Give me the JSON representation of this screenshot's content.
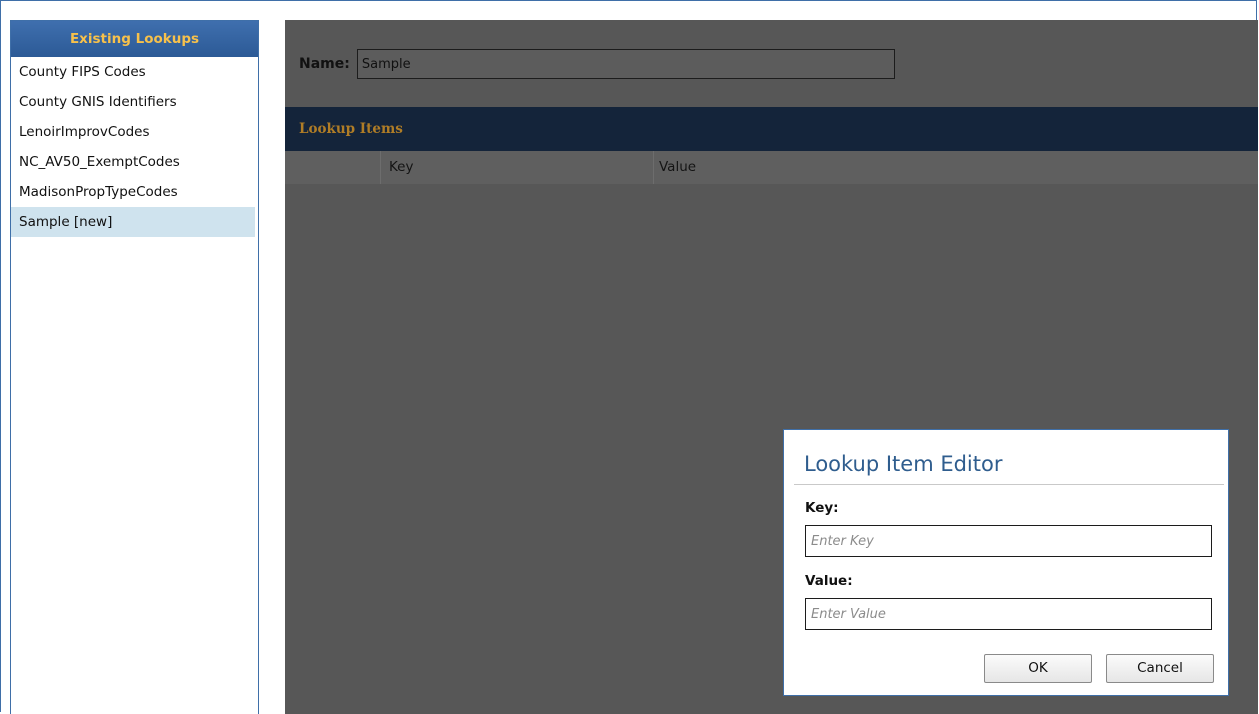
{
  "sidebar": {
    "title": "Existing Lookups",
    "items": [
      {
        "label": "County FIPS Codes",
        "selected": false
      },
      {
        "label": "County GNIS Identifiers",
        "selected": false
      },
      {
        "label": "LenoirImprovCodes",
        "selected": false
      },
      {
        "label": "NC_AV50_ExemptCodes",
        "selected": false
      },
      {
        "label": "MadisonPropTypeCodes",
        "selected": false
      },
      {
        "label": "Sample [new]",
        "selected": true
      }
    ]
  },
  "main": {
    "name_label": "Name:",
    "name_value": "Sample",
    "lookup_items_title": "Lookup Items",
    "columns": {
      "key": "Key",
      "value": "Value"
    }
  },
  "dialog": {
    "title": "Lookup Item Editor",
    "key_label": "Key:",
    "key_placeholder": "Enter Key",
    "value_label": "Value:",
    "value_placeholder": "Enter Value",
    "ok_label": "OK",
    "cancel_label": "Cancel"
  },
  "colors": {
    "accent": "#3f6fa8",
    "header_text": "#f7c14b",
    "selected_row": "#cfe3ee",
    "overlay": "#575757",
    "section_header": "#14243a",
    "dialog_title": "#2f5d8e"
  }
}
